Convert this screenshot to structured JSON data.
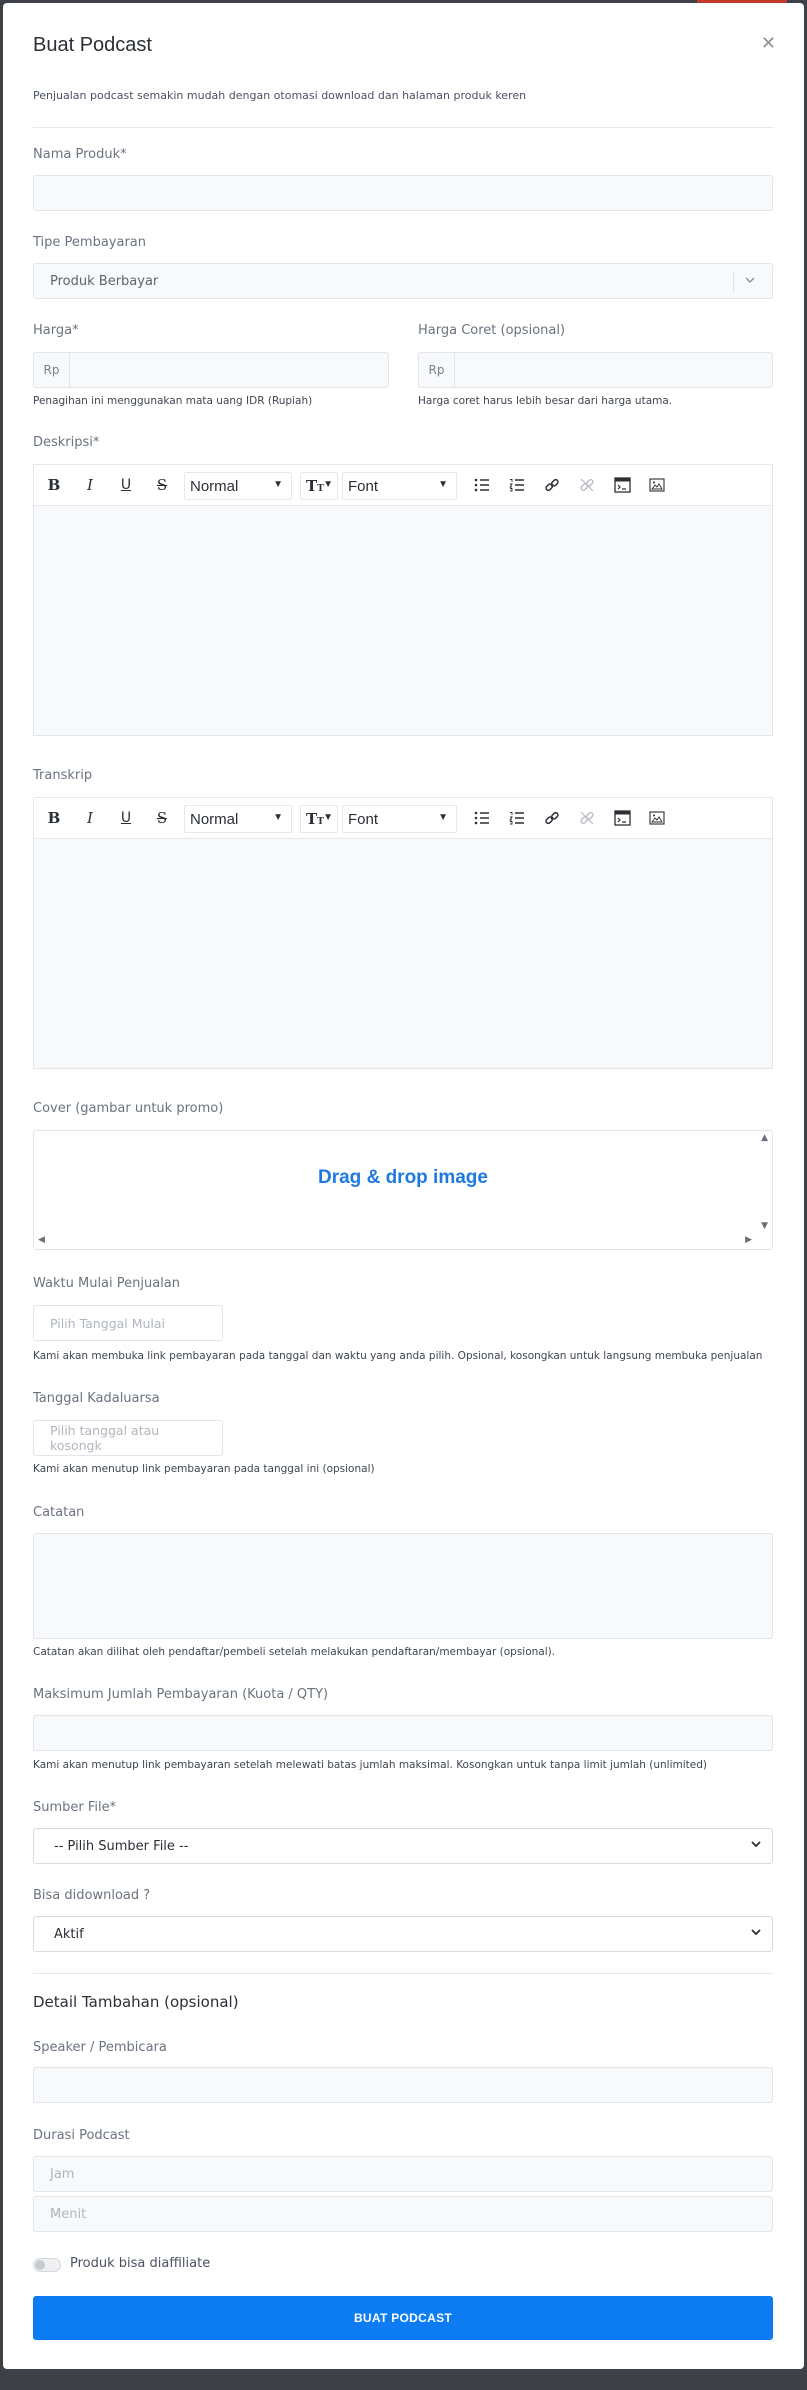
{
  "modal": {
    "title": "Buat Podcast",
    "close_icon": "close-icon",
    "subtitle": "Penjualan podcast semakin mudah dengan otomasi download dan halaman produk keren"
  },
  "fields": {
    "nama_produk": {
      "label": "Nama Produk*",
      "value": ""
    },
    "tipe_pembayaran": {
      "label": "Tipe Pembayaran",
      "value": "Produk Berbayar"
    },
    "harga": {
      "label": "Harga*",
      "prefix": "Rp",
      "value": "",
      "help": "Penagihan ini menggunakan mata uang IDR (Rupiah)"
    },
    "harga_coret": {
      "label": "Harga Coret (opsional)",
      "prefix": "Rp",
      "value": "",
      "help": "Harga coret harus lebih besar dari harga utama."
    },
    "deskripsi": {
      "label": "Deskripsi*"
    },
    "transkrip": {
      "label": "Transkrip"
    },
    "cover": {
      "label": "Cover (gambar untuk promo)",
      "dropzone_text": "Drag & drop image"
    },
    "waktu_mulai": {
      "label": "Waktu Mulai Penjualan",
      "placeholder": "Pilih Tanggal Mulai",
      "help": "Kami akan membuka link pembayaran pada tanggal dan waktu yang anda pilih. Opsional, kosongkan untuk langsung membuka penjualan"
    },
    "tanggal_kadaluarsa": {
      "label": "Tanggal Kadaluarsa",
      "placeholder": "Pilih tanggal atau kosongk",
      "help": "Kami akan menutup link pembayaran pada tanggal ini (opsional)"
    },
    "catatan": {
      "label": "Catatan",
      "help": "Catatan akan dilihat oleh pendaftar/pembeli setelah melakukan pendaftaran/membayar (opsional)."
    },
    "kuota": {
      "label": "Maksimum Jumlah Pembayaran (Kuota / QTY)",
      "help": "Kami akan menutup link pembayaran setelah melewati batas jumlah maksimal. Kosongkan untuk tanpa limit jumlah (unlimited)"
    },
    "sumber_file": {
      "label": "Sumber File*",
      "value": "-- Pilih Sumber File --"
    },
    "bisa_download": {
      "label": "Bisa didownload ?",
      "value": "Aktif"
    }
  },
  "toolbar": {
    "bold": "B",
    "italic": "I",
    "underline": "U",
    "strike": "S",
    "header_select": "Normal",
    "size_icon": "T",
    "font_select": "Font"
  },
  "detail": {
    "title": "Detail Tambahan (opsional)",
    "speaker": {
      "label": "Speaker / Pembicara"
    },
    "durasi": {
      "label": "Durasi Podcast",
      "jam_placeholder": "Jam",
      "menit_placeholder": "Menit"
    },
    "affiliate_label": "Produk bisa diaffiliate",
    "affiliate_on": false
  },
  "submit_label": "BUAT PODCAST",
  "colors": {
    "primary": "#0d7cf2",
    "dropzone_text": "#1f7ae0",
    "backdrop": "#3d4147"
  }
}
